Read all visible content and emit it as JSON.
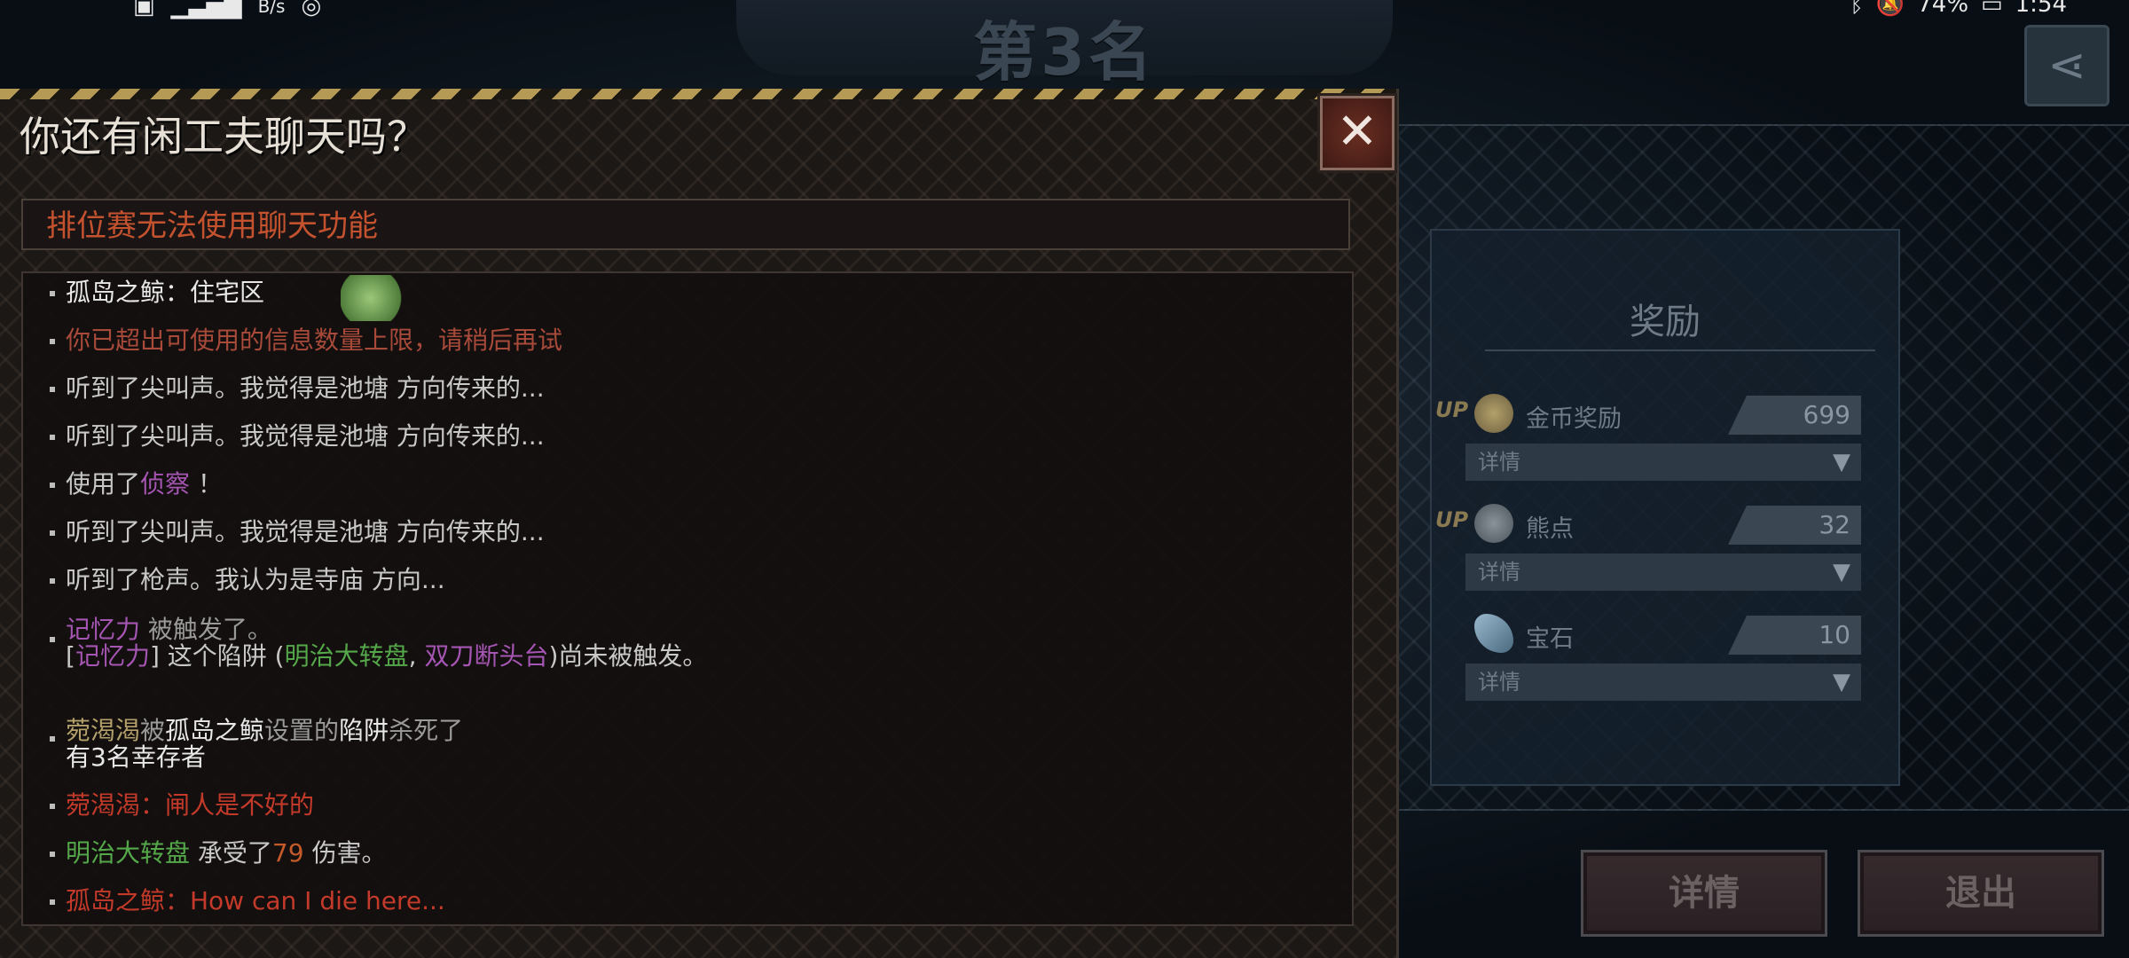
{
  "status_bar": {
    "left_icons": [
      "sim-icon",
      "signal-icon"
    ],
    "net_speed": "B/s",
    "right_text": "74%",
    "time": "1:54"
  },
  "rank": {
    "title": "第3名"
  },
  "reward": {
    "title": "奖励",
    "items": [
      {
        "up": "UP",
        "icon": "coin-icon",
        "label": "金币奖励",
        "value": "699",
        "detail": "详情"
      },
      {
        "up": "UP",
        "icon": "bear-paw-icon",
        "label": "熊点",
        "value": "32",
        "detail": "详情"
      },
      {
        "up": "",
        "icon": "gem-icon",
        "label": "宝石",
        "value": "10",
        "detail": "详情"
      }
    ]
  },
  "buttons": {
    "details": "详情",
    "exit": "退出"
  },
  "chat": {
    "title": "你还有闲工夫聊天吗？",
    "notice": "排位赛无法使用聊天功能",
    "messages": {
      "m0": "孤岛之鲸：住宅区",
      "m1": "你已超出可使用的信息数量上限，请稍后再试",
      "m2": "听到了尖叫声。我觉得是池塘 方向传来的...",
      "m3": "听到了尖叫声。我觉得是池塘 方向传来的...",
      "m4a": "使用了",
      "m4b": "侦察",
      "m4c": " ！",
      "m5": "听到了尖叫声。我觉得是池塘 方向传来的...",
      "m6": "听到了枪声。我认为是寺庙 方向...",
      "m7a": "记忆力",
      "m7b": " 被触发了。",
      "m8a": "[",
      "m8b": "记忆力",
      "m8c": "] 这个陷阱 (",
      "m8d": "明治大转盘",
      "m8e": ", ",
      "m8f": "双刀断头台",
      "m8g": ")尚未被触发。",
      "m9a": "菀渴渴",
      "m9b": "被",
      "m9c": "孤岛之鲸",
      "m9d": "设置的",
      "m9e": "陷阱",
      "m9f": "杀死了",
      "m9g": "有3名幸存者",
      "m10": "菀渴渴：闸人是不好的",
      "m11a": "明治大转盘",
      "m11b": " 承受了",
      "m11c": "79",
      "m11d": " 伤害。",
      "m12": "孤岛之鲸：How can I die here..."
    }
  },
  "colors": {
    "accent_red": "#c43a2a",
    "skill_purple": "#a555b2",
    "trap_green": "#55a84a",
    "hazard_yellow": "#b59a55"
  }
}
